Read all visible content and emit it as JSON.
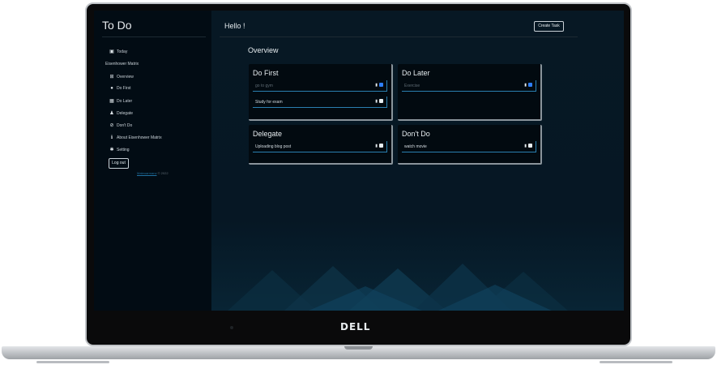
{
  "app": {
    "title": "To Do"
  },
  "sidebar": {
    "items": [
      {
        "icon": "calendar-icon",
        "glyph": "▣",
        "label": "Today"
      }
    ],
    "section_label": "Eisenhower Matrix",
    "matrix_items": [
      {
        "icon": "grid-icon",
        "glyph": "⊞",
        "label": "Overview"
      },
      {
        "icon": "fire-icon",
        "glyph": "●",
        "label": "Do First"
      },
      {
        "icon": "calendar-icon",
        "glyph": "▦",
        "label": "Do Later"
      },
      {
        "icon": "user-plus-icon",
        "glyph": "♟",
        "label": "Delegate"
      },
      {
        "icon": "ban-icon",
        "glyph": "⊘",
        "label": "Don't Do"
      },
      {
        "icon": "info-icon",
        "glyph": "ℹ",
        "label": "About Eisenhower Matrix"
      },
      {
        "icon": "gear-icon",
        "glyph": "✱",
        "label": "Setting"
      }
    ],
    "logout_label": "Log out",
    "footer_link": "Mateoarmanz",
    "footer_text": " © 2022"
  },
  "header": {
    "greeting": "Hello !",
    "create_label": "Create Task"
  },
  "main": {
    "section_title": "Overview"
  },
  "quadrants": [
    {
      "title": "Do First",
      "tasks": [
        {
          "text": "go to gym",
          "done": true
        },
        {
          "text": "Study for exam",
          "done": false
        }
      ]
    },
    {
      "title": "Do Later",
      "tasks": [
        {
          "text": "Exercise",
          "done": true
        }
      ]
    },
    {
      "title": "Delegate",
      "tasks": [
        {
          "text": "Uploading blog post",
          "done": false
        }
      ]
    },
    {
      "title": "Don't Do",
      "tasks": [
        {
          "text": "watch movie",
          "done": false
        }
      ]
    }
  ],
  "device": {
    "brand": "DELL"
  },
  "colors": {
    "accent": "#2a7fb0",
    "background": "#04131d",
    "sidebar": "#020c14"
  }
}
